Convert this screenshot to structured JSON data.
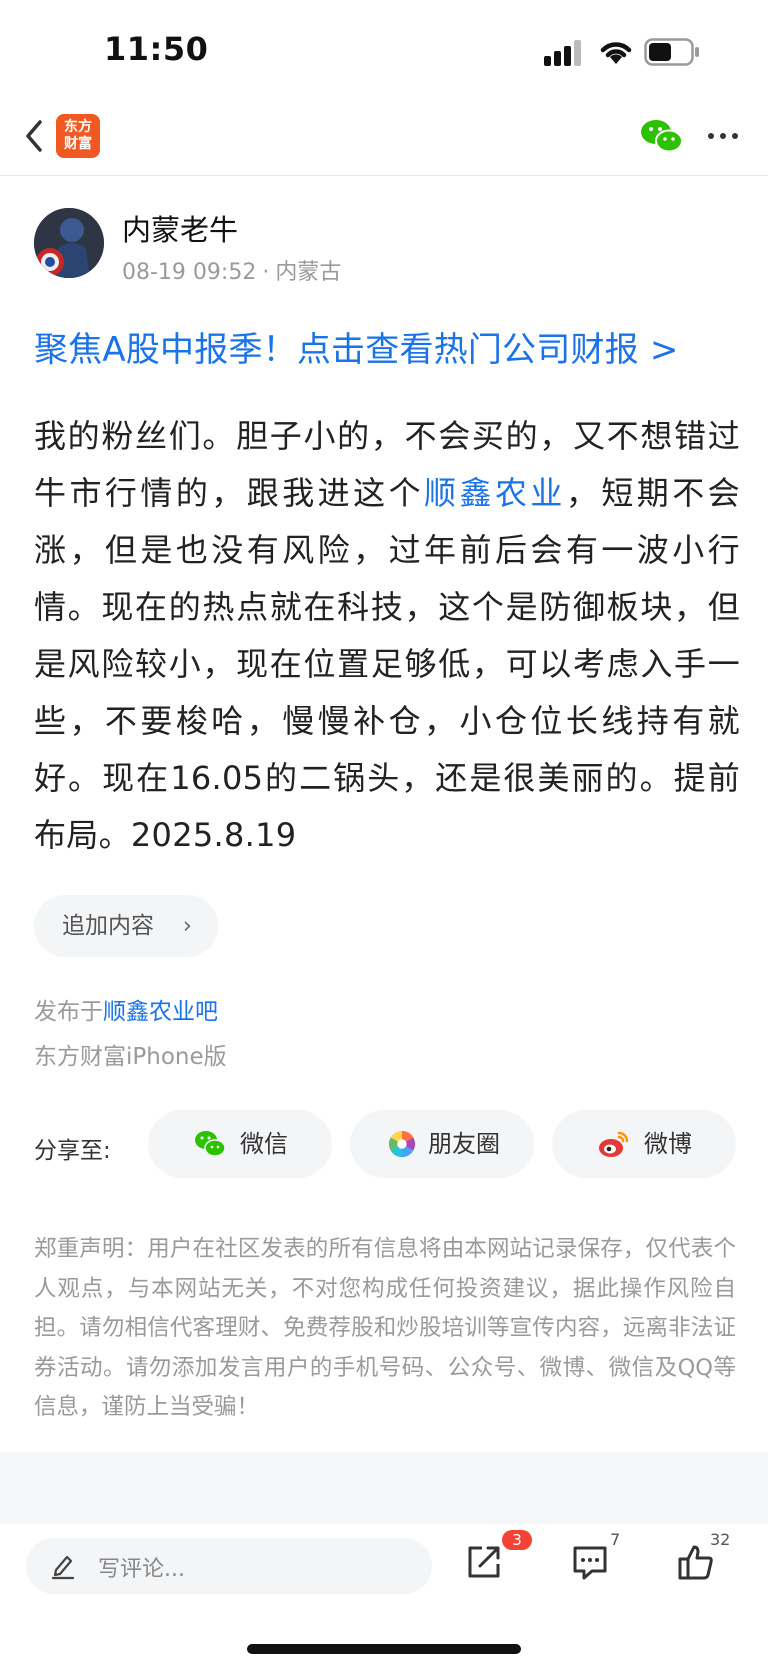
{
  "status_bar": {
    "time": "11:50"
  },
  "nav": {
    "logo_line1": "东方",
    "logo_line2": "财富"
  },
  "author": {
    "name": "内蒙老牛",
    "time": "08-19 09:52",
    "separator": "·",
    "location": "内蒙古"
  },
  "promo_link": "聚焦A股中报季！点击查看热门公司财报 >",
  "post": {
    "text_before": "我的粉丝们。胆子小的，不会买的，又不想错过牛市行情的，跟我进这个",
    "stock_link": "顺鑫农业",
    "text_after": "，短期不会涨，但是也没有风险，过年前后会有一波小行情。现在的热点就在科技，这个是防御板块，但是风险较小，现在位置足够低，可以考虑入手一些，不要梭哈，慢慢补仓，小仓位长线持有就好。现在16.05的二锅头，还是很美丽的。提前布局。2025.8.19"
  },
  "append_button": {
    "label": "追加内容",
    "chevron": "›"
  },
  "published": {
    "prefix": "发布于",
    "forum": "顺鑫农业吧"
  },
  "client": "东方财富iPhone版",
  "share": {
    "label": "分享至:",
    "wechat": "微信",
    "moments": "朋友圈",
    "weibo": "微博"
  },
  "disclaimer": "郑重声明：用户在社区发表的所有信息将由本网站记录保存，仅代表个人观点，与本网站无关，不对您构成任何投资建议，据此操作风险自担。请勿相信代客理财、免费荐股和炒股培训等宣传内容，远离非法证券活动。请勿添加发言用户的手机号码、公众号、微博、微信及QQ等信息，谨防上当受骗！",
  "bottom_bar": {
    "comment_placeholder": "写评论...",
    "share_badge": "3",
    "comment_count": "7",
    "like_count": "32"
  },
  "colors": {
    "brand": "#f25822",
    "link": "#1a73e8",
    "badge": "#f44336",
    "wechat": "#2dc100"
  }
}
